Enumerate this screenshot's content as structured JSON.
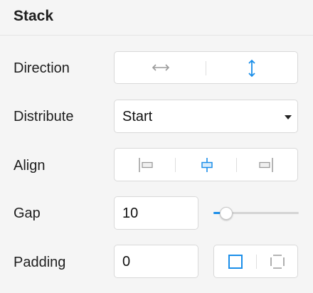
{
  "panel": {
    "title": "Stack"
  },
  "rows": {
    "direction": {
      "label": "Direction",
      "options": [
        "horizontal-arrows-icon",
        "vertical-arrows-icon"
      ],
      "selected": "vertical"
    },
    "distribute": {
      "label": "Distribute",
      "value": "Start"
    },
    "align": {
      "label": "Align",
      "options": [
        "align-left-icon",
        "align-center-icon",
        "align-right-icon"
      ],
      "selected": "center"
    },
    "gap": {
      "label": "Gap",
      "value": "10",
      "slider_fraction": 0.15
    },
    "padding": {
      "label": "Padding",
      "value": "0",
      "options": [
        "padding-uniform-icon",
        "padding-individual-icon"
      ],
      "selected": "uniform"
    }
  },
  "colors": {
    "accent": "#1a8ee9",
    "inactive_icon": "#9b9b9b",
    "background": "#f5f5f5"
  }
}
